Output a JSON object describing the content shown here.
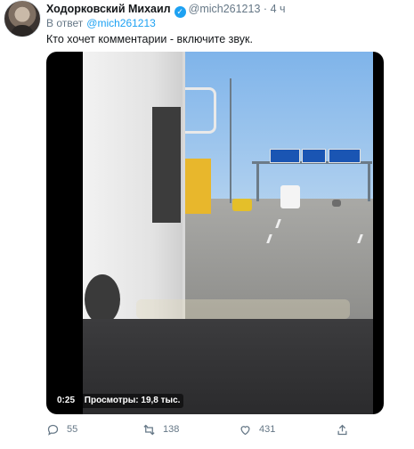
{
  "tweet": {
    "author_name": "Ходорковский Михаил",
    "author_handle": "@mich261213",
    "separator": "·",
    "time": "4 ч",
    "reply_prefix": "В ответ",
    "reply_to": "@mich261213",
    "text": "Кто хочет комментарии - включите звук."
  },
  "video": {
    "elapsed": "0:25",
    "views_text": "Просмотры: 19,8 тыс."
  },
  "actions": {
    "reply_count": "55",
    "retweet_count": "138",
    "like_count": "431"
  },
  "colors": {
    "accent": "#1da1f2",
    "secondary_text": "#657786",
    "primary_text": "#14171a"
  },
  "icons": [
    "verified-badge-icon",
    "reply-icon",
    "retweet-icon",
    "like-icon",
    "share-icon"
  ]
}
